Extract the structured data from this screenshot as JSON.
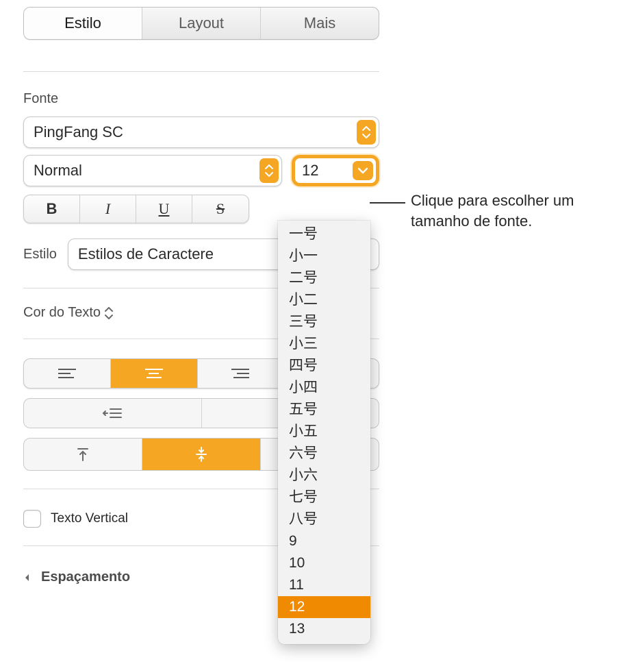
{
  "tabs": {
    "style": "Estilo",
    "layout": "Layout",
    "more": "Mais"
  },
  "font": {
    "section": "Fonte",
    "family": "PingFang SC",
    "weight": "Normal",
    "size": "12",
    "bold": "B",
    "italic": "I",
    "underline": "U",
    "strike": "S"
  },
  "style_row": {
    "label": "Estilo",
    "char_styles": "Estilos de Caractere"
  },
  "text_color": "Cor do Texto",
  "vertical_text": "Texto Vertical",
  "spacing": "Espaçamento",
  "size_menu": {
    "options": [
      "一号",
      "小一",
      "二号",
      "小二",
      "三号",
      "小三",
      "四号",
      "小四",
      "五号",
      "小五",
      "六号",
      "小六",
      "七号",
      "八号",
      "9",
      "10",
      "11",
      "12",
      "13"
    ],
    "selected": "12"
  },
  "callout": "Clique para escolher um tamanho de fonte."
}
